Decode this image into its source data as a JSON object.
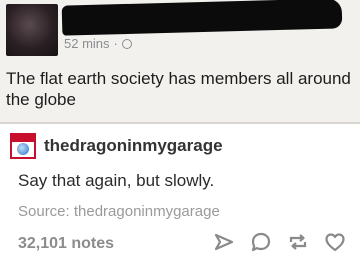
{
  "facebook_post": {
    "timestamp": "52 mins",
    "separator": "·",
    "text": "The flat earth society has members all around the globe",
    "icons": {
      "privacy": "globe-icon"
    }
  },
  "tumblr_post": {
    "blog_name": "thedragoninmygarage",
    "reply": "Say that again, but slowly.",
    "source": "Source: thedragoninmygarage",
    "notes": "32,101 notes",
    "icons": {
      "share": "share-icon",
      "reply": "reply-icon",
      "reblog": "reblog-icon",
      "like": "heart-icon"
    }
  },
  "colors": {
    "accent_red": "#c8102e",
    "muted_text": "#8c8c8c",
    "icon_gray": "#8a8a8a"
  }
}
